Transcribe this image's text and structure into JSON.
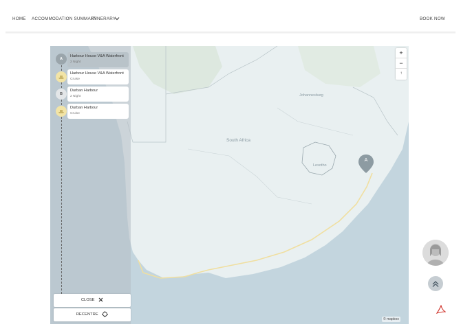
{
  "nav": {
    "home": "HOME",
    "accommodation": "ACCOMMODATION SUMMARY",
    "itinerary": "ITINERARY",
    "book": "BOOK NOW"
  },
  "map": {
    "country_label": "South Africa",
    "city_labels": [
      "Johannesburg",
      "Lesotho"
    ],
    "zoom_in": "+",
    "zoom_out": "−",
    "compass": "↑",
    "marker_label": "A",
    "attribution": "© mapbox"
  },
  "itinerary": {
    "stops": [
      {
        "badge": "A",
        "title": "Harbour House V&A Waterfront",
        "subtitle": "2 Night",
        "active": true
      },
      {
        "badge": "",
        "title": "Harbour House V&A Waterfront",
        "subtitle": "Cruise",
        "active": false
      },
      {
        "badge": "B",
        "title": "Durban Harbour",
        "subtitle": "2 Night",
        "active": false
      },
      {
        "badge": "",
        "title": "Durban Harbour",
        "subtitle": "Cruise",
        "active": false
      }
    ],
    "close_label": "CLOSE",
    "recentre_label": "RECENTRE"
  },
  "colors": {
    "map_water": "#c3d5de",
    "map_land": "#e9f0f1",
    "route": "#f0dfa0",
    "badge_gold": "#f2e4a6"
  }
}
